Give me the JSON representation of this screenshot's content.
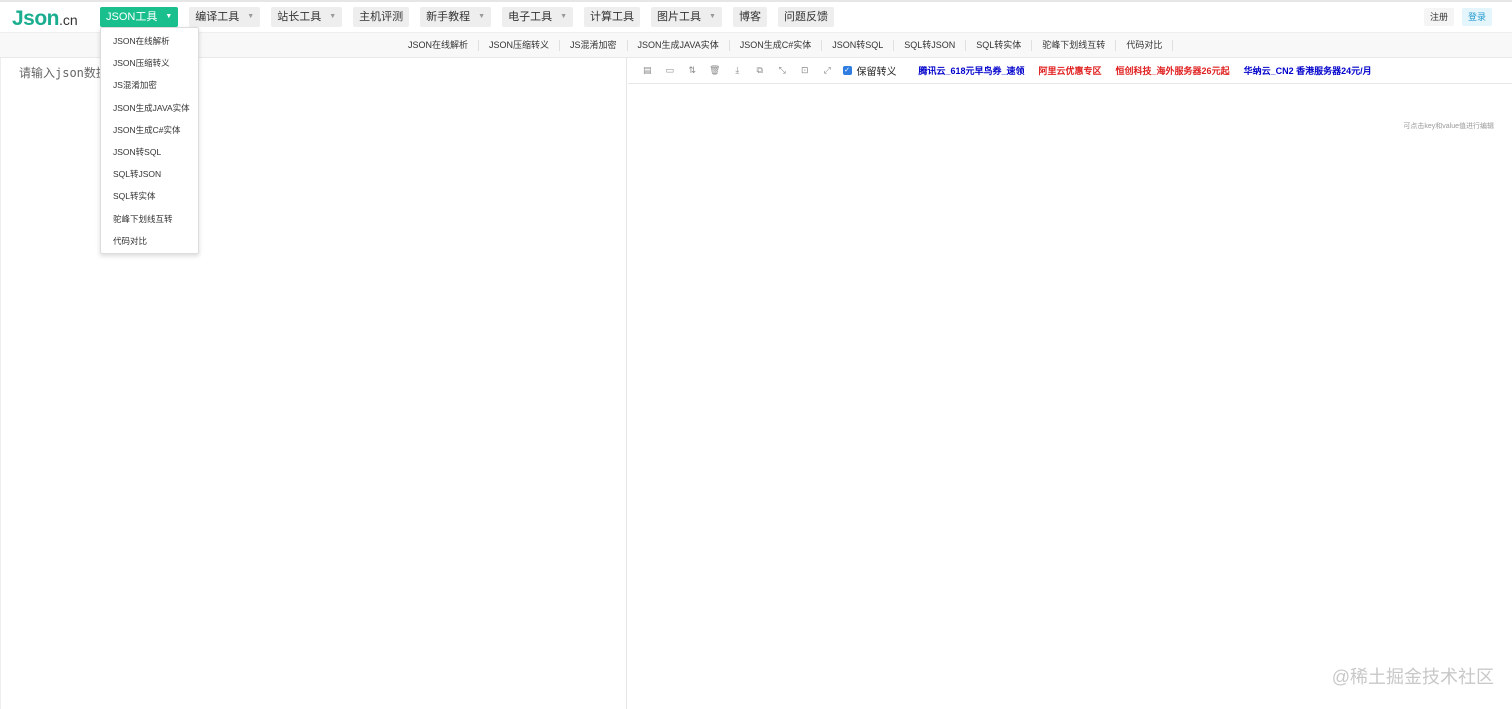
{
  "logo": {
    "main": "Json",
    "tld": ".cn"
  },
  "nav": [
    {
      "label": "JSON工具",
      "caret": "▼"
    },
    {
      "label": "编译工具",
      "caret": "▼"
    },
    {
      "label": "站长工具",
      "caret": "▼"
    },
    {
      "label": "主机评测"
    },
    {
      "label": "新手教程",
      "caret": "▼"
    },
    {
      "label": "电子工具",
      "caret": "▼"
    },
    {
      "label": "计算工具"
    },
    {
      "label": "图片工具",
      "caret": "▼"
    },
    {
      "label": "博客"
    },
    {
      "label": "问题反馈"
    }
  ],
  "auth": {
    "register": "注册",
    "login": "登录"
  },
  "subnav": [
    "JSON在线解析",
    "JSON压缩转义",
    "JS混淆加密",
    "JSON生成JAVA实体",
    "JSON生成C#实体",
    "JSON转SQL",
    "SQL转JSON",
    "SQL转实体",
    "驼峰下划线互转",
    "代码对比"
  ],
  "dropdown": [
    "JSON在线解析",
    "JSON压缩转义",
    "JS混淆加密",
    "JSON生成JAVA实体",
    "JSON生成C#实体",
    "JSON转SQL",
    "SQL转JSON",
    "SQL转实体",
    "驼峰下划线互转",
    "代码对比"
  ],
  "editor": {
    "placeholder": "请输入json数据..."
  },
  "toolbar": {
    "icons": [
      {
        "name": "format-icon",
        "glyph": "▤"
      },
      {
        "name": "compress-icon",
        "glyph": "▭"
      },
      {
        "name": "sort-icon",
        "glyph": "⇅"
      },
      {
        "name": "delete-icon",
        "glyph": "🗑"
      },
      {
        "name": "download-icon",
        "glyph": "⤓"
      },
      {
        "name": "copy-icon",
        "glyph": "⧉"
      },
      {
        "name": "collapse-icon",
        "glyph": "⤡"
      },
      {
        "name": "image-icon",
        "glyph": "⊡"
      },
      {
        "name": "fullscreen-icon",
        "glyph": "⤢"
      }
    ],
    "keep_escape_label": "保留转义",
    "keep_escape_checked": true,
    "checkbox_color": "#2f7de1"
  },
  "promos": [
    {
      "text": "腾讯云_618元早鸟券_速领",
      "color": "#0000cc"
    },
    {
      "text": "阿里云优惠专区",
      "color": "#e02020"
    },
    {
      "text": "恒创科技_海外服务器26元起",
      "color": "#e02020"
    },
    {
      "text": "华纳云_CN2 香港服务器24元/月",
      "color": "#0000cc"
    }
  ],
  "hint": "可点击key和value值进行编辑",
  "watermark": "@稀土掘金技术社区",
  "colors": {
    "accent": "#19c08e",
    "logo": "#1aad8f"
  }
}
